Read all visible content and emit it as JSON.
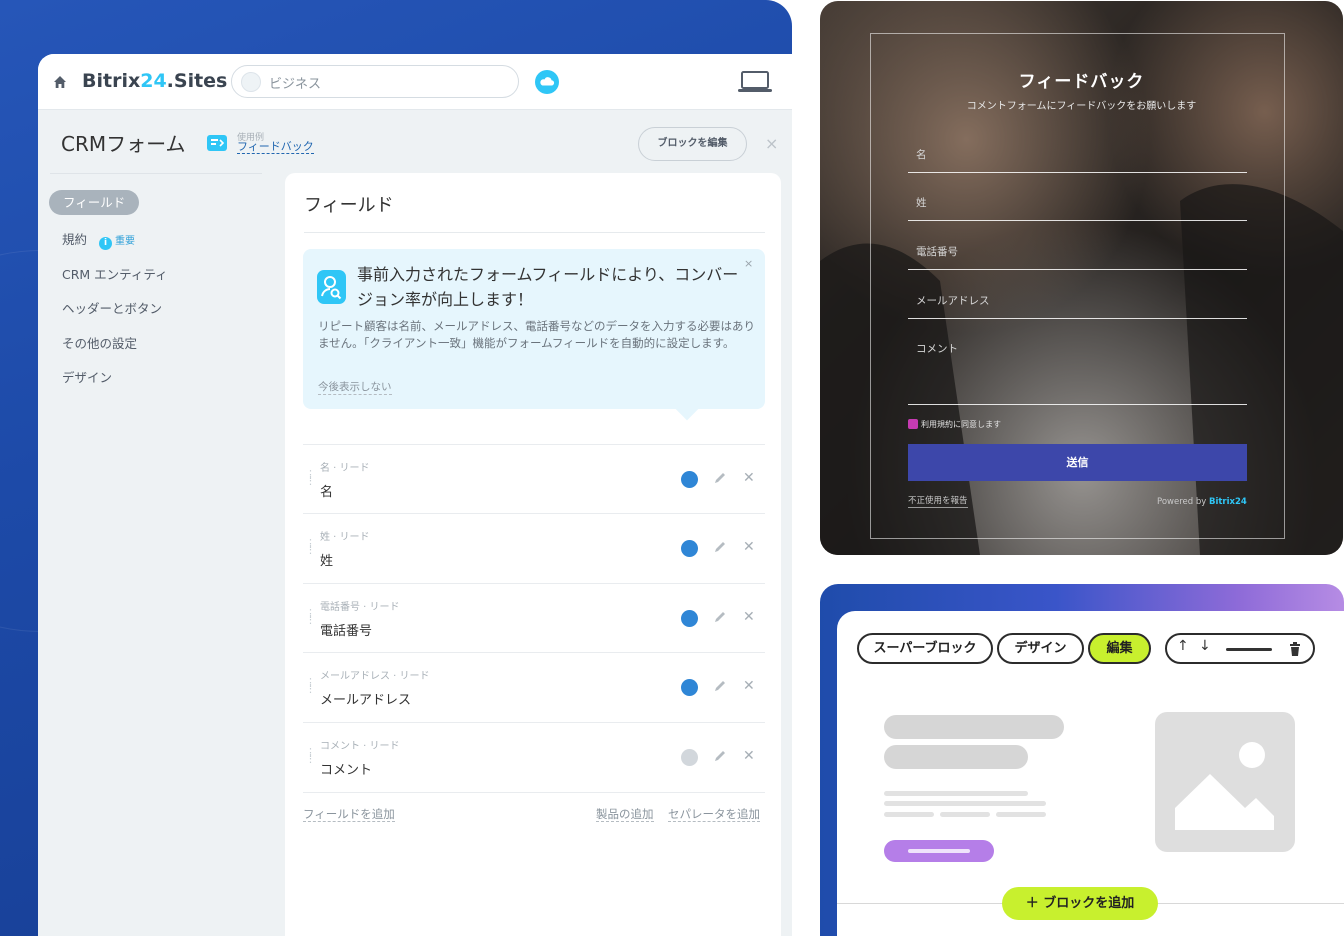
{
  "left_panel": {
    "topbar": {
      "brand_prefix": "Bitrix",
      "brand_num": "24",
      "brand_suffix": ".Sites",
      "site_selector": "ビジネス"
    },
    "header": {
      "title": "CRMフォーム",
      "usage_caption": "使用例",
      "usage_link": "フィードバック",
      "edit_block_button": "ブロックを編集",
      "close": "×"
    },
    "sidebar": {
      "items": [
        {
          "label": "フィールド",
          "active": true
        },
        {
          "label": "規約",
          "badge": "重要"
        },
        {
          "label": "CRM エンティティ"
        },
        {
          "label": "ヘッダーとボタン"
        },
        {
          "label": "その他の設定"
        },
        {
          "label": "デザイン"
        }
      ]
    },
    "main": {
      "title": "フィールド",
      "tip": {
        "title": "事前入力されたフォームフィールドにより、コンバージョン率が向上します！",
        "body": "リピート顧客は名前、メールアドレス、電話番号などのデータを入力する必要はありません。「クライアント一致」機能がフォームフィールドを自動的に設定します。",
        "dismiss": "今後表示しない",
        "close": "×"
      },
      "fields": [
        {
          "caption": "名 · リード",
          "name": "名"
        },
        {
          "caption": "姓 · リード",
          "name": "姓"
        },
        {
          "caption": "電話番号 · リード",
          "name": "電話番号"
        },
        {
          "caption": "メールアドレス · リード",
          "name": "メールアドレス"
        },
        {
          "caption": "コメント · リード",
          "name": "コメント"
        }
      ],
      "add_field": "フィールドを追加",
      "add_product": "製品の追加",
      "add_separator": "セパレータを追加"
    }
  },
  "feedback_form": {
    "title": "フィードバック",
    "subtitle": "コメントフォームにフィードバックをお願いします",
    "fields": [
      "名",
      "姓",
      "電話番号",
      "メールアドレス",
      "コメント"
    ],
    "agree_label": "利用規約に同意します",
    "submit": "送信",
    "report_abuse": "不正使用を報告",
    "powered_prefix": "Powered by ",
    "powered_brand": "Bitrix24"
  },
  "block_editor": {
    "toolbar": {
      "super_block": "スーパーブロック",
      "design": "デザイン",
      "edit": "編集",
      "up": "↑",
      "down": "↓"
    },
    "add_block": "＋ ブロックを追加",
    "accent_color": "#c8f02e"
  },
  "colors": {
    "brand_blue": "#1d4aa8",
    "accent_cyan": "#2fc6f6",
    "submit_button": "#3d47aa"
  }
}
